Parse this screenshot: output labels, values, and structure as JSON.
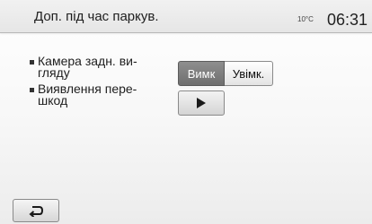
{
  "header": {
    "title": "Доп. під час паркув.",
    "temperature": "10°C",
    "time": "06:31"
  },
  "settings": {
    "items": [
      {
        "label": "Камера задн. ви-гляду"
      },
      {
        "label": "Виявлення пере-шкод"
      }
    ],
    "camera_toggle": {
      "off_label": "Вимк",
      "on_label": "Увімк.",
      "selected": "off_label"
    },
    "obstacle_detection": {
      "button_icon": "play-icon"
    }
  },
  "footer": {
    "back_icon": "back-arrow-icon"
  },
  "colors": {
    "selected_toggle": "#7c7c7c",
    "header_background": "#e9e9e9"
  }
}
